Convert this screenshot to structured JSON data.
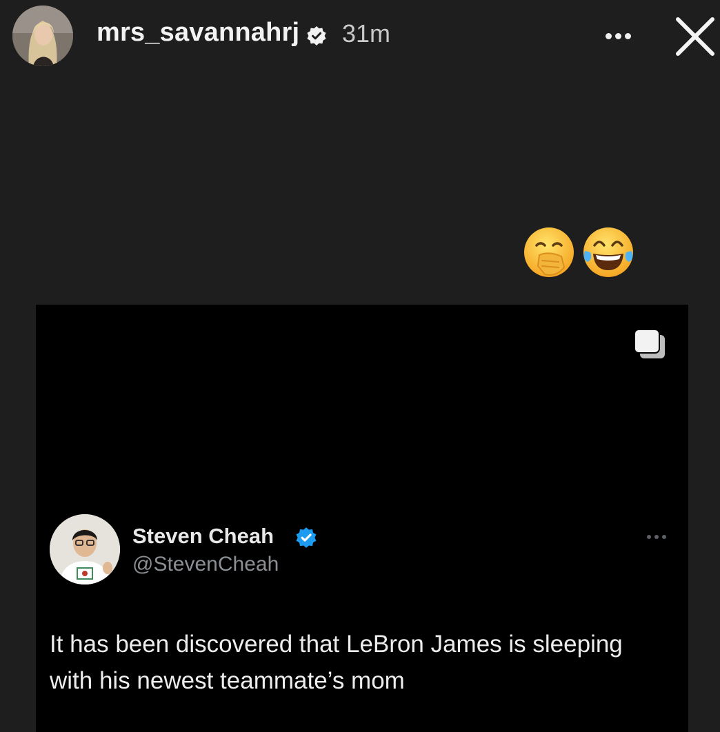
{
  "story": {
    "username": "mrs_savannahrj",
    "timestamp": "31m",
    "avatar_icon": "profile-photo",
    "verified_icon": "verified-badge-icon",
    "more_icon": "more-options-icon",
    "close_icon": "close-icon"
  },
  "stickers": {
    "emojis": [
      "hand-over-mouth-emoji",
      "tears-of-joy-emoji"
    ]
  },
  "tweet": {
    "author_name": "Steven Cheah",
    "author_handle": "@StevenCheah",
    "text": "It has been discovered that LeBron James is sleeping with his newest teammate’s mom",
    "verified_color": "#1d9bf0",
    "copy_icon": "copy-icon",
    "more_icon": "more-options-icon"
  },
  "colors": {
    "story_background": "#1e1e1e",
    "card_background": "#000000",
    "handle_gray": "#8b8f94"
  }
}
